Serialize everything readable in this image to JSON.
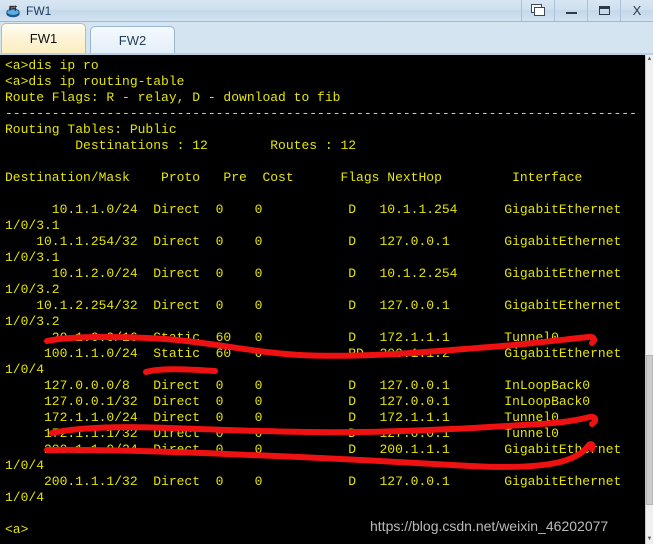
{
  "window": {
    "title": "FW1",
    "icon": "router-icon",
    "buttons": [
      {
        "name": "restore-button",
        "glyph": "restore-icon",
        "label": ""
      },
      {
        "name": "minimize-button",
        "glyph": "minimize-icon",
        "label": ""
      },
      {
        "name": "maximize-button",
        "glyph": "maximize-icon",
        "label": ""
      },
      {
        "name": "close-button",
        "glyph": "close-icon",
        "label": "X"
      }
    ]
  },
  "tabs": [
    {
      "label": "FW1",
      "active": true
    },
    {
      "label": "FW2",
      "active": false
    }
  ],
  "terminal": {
    "prompt": "<a>",
    "lines": [
      "<a>dis ip ro",
      "<a>dis ip routing-table",
      "Route Flags: R - relay, D - download to fib",
      "---------------------------------------------------------------------------------",
      "Routing Tables: Public",
      "         Destinations : 12        Routes : 12",
      "",
      "Destination/Mask    Proto   Pre  Cost      Flags NextHop         Interface",
      "",
      "      10.1.1.0/24  Direct  0    0           D   10.1.1.254      GigabitEthernet",
      "1/0/3.1",
      "    10.1.1.254/32  Direct  0    0           D   127.0.0.1       GigabitEthernet",
      "1/0/3.1",
      "      10.1.2.0/24  Direct  0    0           D   10.1.2.254      GigabitEthernet",
      "1/0/3.2",
      "    10.1.2.254/32  Direct  0    0           D   127.0.0.1       GigabitEthernet",
      "1/0/3.2",
      "      20.1.0.0/16  Static  60   0           D   172.1.1.1       Tunnel0",
      "     100.1.1.0/24  Static  60   0           RD  200.1.1.2       GigabitEthernet",
      "1/0/4",
      "     127.0.0.0/8   Direct  0    0           D   127.0.0.1       InLoopBack0",
      "     127.0.0.1/32  Direct  0    0           D   127.0.0.1       InLoopBack0",
      "     172.1.1.0/24  Direct  0    0           D   172.1.1.1       Tunnel0",
      "     172.1.1.1/32  Direct  0    0           D   127.0.0.1       Tunnel0",
      "     200.1.1.0/24  Direct  0    0           D   200.1.1.1       GigabitEthernet",
      "1/0/4",
      "     200.1.1.1/32  Direct  0    0           D   127.0.0.1       GigabitEthernet",
      "1/0/4",
      "",
      "<a>"
    ],
    "flags_legend": "Route Flags: R - relay, D - download to fib",
    "routing_table_name": "Routing Tables: Public",
    "destinations": "12",
    "routes": "12",
    "columns": [
      "Destination/Mask",
      "Proto",
      "Pre",
      "Cost",
      "Flags",
      "NextHop",
      "Interface"
    ],
    "rows": [
      {
        "destination": "10.1.1.0/24",
        "proto": "Direct",
        "pre": "0",
        "cost": "0",
        "flags": "D",
        "nexthop": "10.1.1.254",
        "interface": "GigabitEthernet1/0/3.1"
      },
      {
        "destination": "10.1.1.254/32",
        "proto": "Direct",
        "pre": "0",
        "cost": "0",
        "flags": "D",
        "nexthop": "127.0.0.1",
        "interface": "GigabitEthernet1/0/3.1"
      },
      {
        "destination": "10.1.2.0/24",
        "proto": "Direct",
        "pre": "0",
        "cost": "0",
        "flags": "D",
        "nexthop": "10.1.2.254",
        "interface": "GigabitEthernet1/0/3.2"
      },
      {
        "destination": "10.1.2.254/32",
        "proto": "Direct",
        "pre": "0",
        "cost": "0",
        "flags": "D",
        "nexthop": "127.0.0.1",
        "interface": "GigabitEthernet1/0/3.2"
      },
      {
        "destination": "20.1.0.0/16",
        "proto": "Static",
        "pre": "60",
        "cost": "0",
        "flags": "D",
        "nexthop": "172.1.1.1",
        "interface": "Tunnel0"
      },
      {
        "destination": "100.1.1.0/24",
        "proto": "Static",
        "pre": "60",
        "cost": "0",
        "flags": "RD",
        "nexthop": "200.1.1.2",
        "interface": "GigabitEthernet1/0/4"
      },
      {
        "destination": "127.0.0.0/8",
        "proto": "Direct",
        "pre": "0",
        "cost": "0",
        "flags": "D",
        "nexthop": "127.0.0.1",
        "interface": "InLoopBack0"
      },
      {
        "destination": "127.0.0.1/32",
        "proto": "Direct",
        "pre": "0",
        "cost": "0",
        "flags": "D",
        "nexthop": "127.0.0.1",
        "interface": "InLoopBack0"
      },
      {
        "destination": "172.1.1.0/24",
        "proto": "Direct",
        "pre": "0",
        "cost": "0",
        "flags": "D",
        "nexthop": "172.1.1.1",
        "interface": "Tunnel0"
      },
      {
        "destination": "172.1.1.1/32",
        "proto": "Direct",
        "pre": "0",
        "cost": "0",
        "flags": "D",
        "nexthop": "127.0.0.1",
        "interface": "Tunnel0"
      },
      {
        "destination": "200.1.1.0/24",
        "proto": "Direct",
        "pre": "0",
        "cost": "0",
        "flags": "D",
        "nexthop": "200.1.1.1",
        "interface": "GigabitEthernet1/0/4"
      },
      {
        "destination": "200.1.1.1/32",
        "proto": "Direct",
        "pre": "0",
        "cost": "0",
        "flags": "D",
        "nexthop": "127.0.0.1",
        "interface": "GigabitEthernet1/0/4"
      }
    ]
  },
  "annotations": {
    "color": "#ee1111",
    "marks": [
      {
        "name": "strike-20-1-0-0-and-100-1-1-0"
      },
      {
        "name": "underline-100-1-1-0-proto"
      },
      {
        "name": "strike-172-1-1-0"
      },
      {
        "name": "strike-172-1-1-1-to-200-1-1-0"
      }
    ]
  },
  "watermark": {
    "text": "https://blog.csdn.net/weixin_46202077"
  },
  "colors": {
    "terminal_bg": "#000000",
    "terminal_fg": "#e5e500",
    "annotation_red": "#ee1111",
    "titlebar": "#cfe0ef",
    "tab_active": "#fbeec0"
  }
}
